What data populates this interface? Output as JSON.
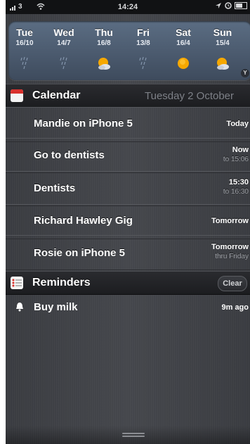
{
  "status_bar": {
    "carrier": "3",
    "time": "14:24",
    "colors": {
      "bar": "#111214",
      "text": "#d9dadc"
    }
  },
  "weather": {
    "days": [
      {
        "name": "Tue",
        "date": "16/10",
        "icon": "rain-icon"
      },
      {
        "name": "Wed",
        "date": "14/7",
        "icon": "rain-icon"
      },
      {
        "name": "Thu",
        "date": "16/8",
        "icon": "partly-cloudy-icon"
      },
      {
        "name": "Fri",
        "date": "13/8",
        "icon": "rain-icon"
      },
      {
        "name": "Sat",
        "date": "16/4",
        "icon": "sun-icon"
      },
      {
        "name": "Sun",
        "date": "15/4",
        "icon": "partly-cloudy-icon"
      }
    ],
    "badge": "Y"
  },
  "calendar": {
    "title": "Calendar",
    "date": "Tuesday 2 October",
    "events": [
      {
        "title": "Mandie on iPhone 5",
        "when": "Today",
        "sub": ""
      },
      {
        "title": "Go to dentists",
        "when": "Now",
        "sub": "to 15:06"
      },
      {
        "title": "Dentists",
        "when": "15:30",
        "sub": "to 16:30"
      },
      {
        "title": "Richard Hawley Gig",
        "when": "Tomorrow",
        "sub": ""
      },
      {
        "title": "Rosie on iPhone 5",
        "when": "Tomorrow",
        "sub": "thru Friday"
      }
    ]
  },
  "reminders": {
    "title": "Reminders",
    "clear_label": "Clear",
    "items": [
      {
        "title": "Buy milk",
        "when": "9m ago"
      }
    ]
  },
  "theme": {
    "accent_sun": "#f6a800",
    "calendar_icon_red": "#d9312d",
    "linen_bg": "#404247"
  }
}
